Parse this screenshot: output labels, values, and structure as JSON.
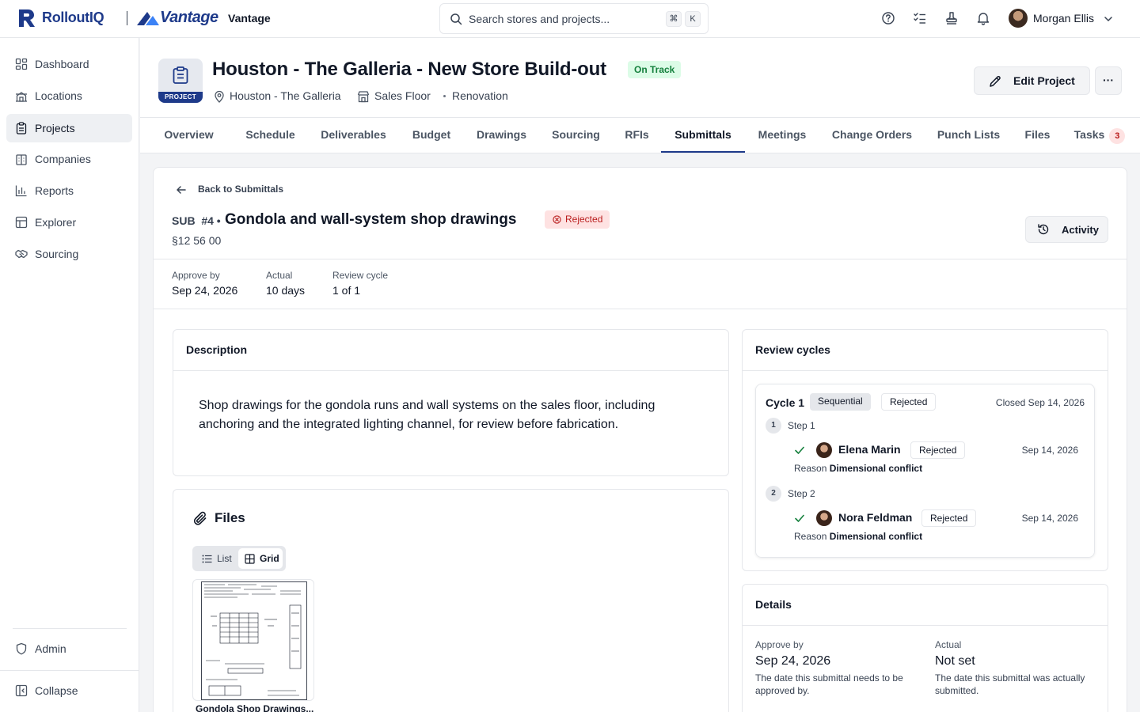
{
  "brand": {
    "app_name": "RolloutIQ",
    "client_logo": "Vantage",
    "client_name": "Vantage"
  },
  "search": {
    "placeholder": "Search stores and projects...",
    "shortcut_mod": "⌘",
    "shortcut_key": "K"
  },
  "user": {
    "name": "Morgan Ellis"
  },
  "sidebar": {
    "items": [
      {
        "label": "Dashboard",
        "icon": "dashboard-icon"
      },
      {
        "label": "Locations",
        "icon": "building-icon"
      },
      {
        "label": "Projects",
        "icon": "clipboard-icon",
        "active": true
      },
      {
        "label": "Companies",
        "icon": "companies-icon"
      },
      {
        "label": "Reports",
        "icon": "bar-chart-icon"
      },
      {
        "label": "Explorer",
        "icon": "table-icon"
      },
      {
        "label": "Sourcing",
        "icon": "handshake-icon"
      }
    ],
    "admin": "Admin",
    "collapse": "Collapse"
  },
  "project": {
    "icon_label": "PROJECT",
    "title": "Houston - The Galleria - New Store Build-out",
    "status": "On Track",
    "location": "Houston - The Galleria",
    "area": "Sales Floor",
    "type": "Renovation",
    "edit_label": "Edit Project",
    "more_label": "···"
  },
  "tabs": [
    {
      "label": "Overview"
    },
    {
      "label": "Schedule"
    },
    {
      "label": "Deliverables"
    },
    {
      "label": "Budget"
    },
    {
      "label": "Drawings"
    },
    {
      "label": "Sourcing"
    },
    {
      "label": "RFIs"
    },
    {
      "label": "Submittals",
      "active": true
    },
    {
      "label": "Meetings"
    },
    {
      "label": "Change Orders"
    },
    {
      "label": "Punch Lists"
    },
    {
      "label": "Files"
    },
    {
      "label": "Tasks",
      "count": "3"
    }
  ],
  "submittal": {
    "back_label": "Back to Submittals",
    "prefix": "SUB  #4 •",
    "title": "Gondola and wall-system shop drawings",
    "status": "Rejected",
    "spec": "§12 56 00",
    "activity_label": "Activity",
    "stats": [
      {
        "label": "Approve by",
        "value": "Sep 24, 2026"
      },
      {
        "label": "Actual",
        "value": "10 days"
      },
      {
        "label": "Review cycle",
        "value": "1 of 1"
      }
    ],
    "description_title": "Description",
    "description": "Shop drawings for the gondola runs and wall systems on the sales floor, including anchoring and the integrated lighting channel, for review before fabrication.",
    "files_title": "Files",
    "view_list": "List",
    "view_grid": "Grid",
    "file_name": "Gondola Shop Drawings..."
  },
  "review": {
    "title": "Review cycles",
    "cycle": {
      "name": "Cycle 1",
      "mode": "Sequential",
      "status": "Rejected",
      "closed": "Closed Sep 14, 2026",
      "steps": [
        {
          "num": "1",
          "label": "Step 1",
          "reviewer": "Elena Marin",
          "status": "Rejected",
          "date": "Sep 14, 2026",
          "reason_label": "Reason",
          "reason": "Dimensional conflict"
        },
        {
          "num": "2",
          "label": "Step 2",
          "reviewer": "Nora Feldman",
          "status": "Rejected",
          "date": "Sep 14, 2026",
          "reason_label": "Reason",
          "reason": "Dimensional conflict"
        }
      ]
    }
  },
  "details": {
    "title": "Details",
    "approve_by_label": "Approve by",
    "approve_by": "Sep 24, 2026",
    "approve_by_help": "The date this submittal needs to be approved by.",
    "actual_label": "Actual",
    "actual": "Not set",
    "actual_help": "The date this submittal was actually submitted."
  },
  "colors": {
    "brand_navy": "#1e3a8a",
    "success_bg": "#dcfce7",
    "success_text": "#15803d",
    "danger_bg": "#fee2e2",
    "danger_text": "#b91c1c"
  }
}
